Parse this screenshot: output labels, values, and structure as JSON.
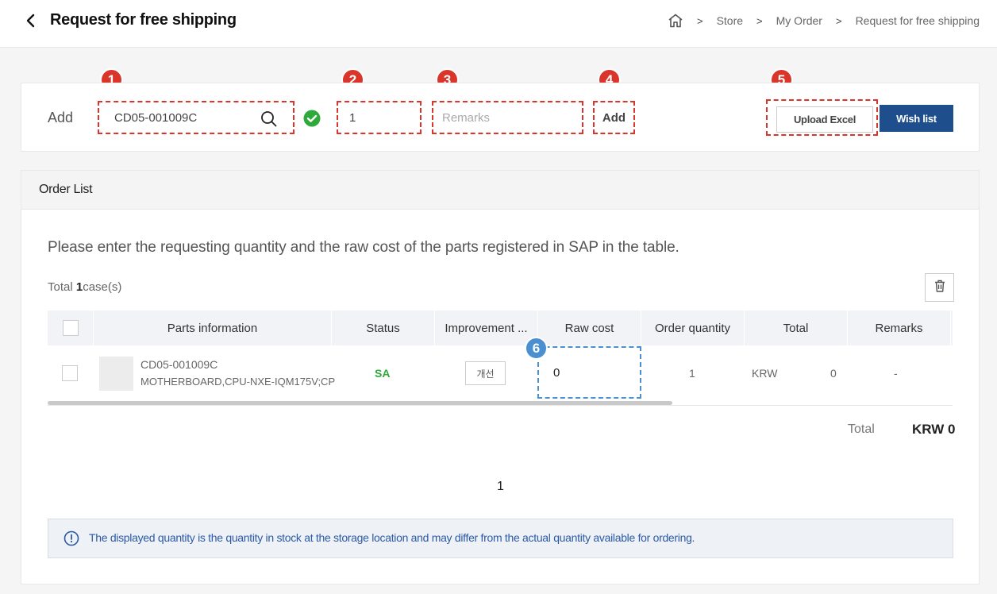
{
  "header": {
    "title": "Request for free shipping",
    "breadcrumb": [
      "Store",
      "My Order",
      "Request for free shipping"
    ]
  },
  "add_bar": {
    "label": "Add",
    "part_code_value": "CD05-001009C",
    "quantity_value": "1",
    "remarks_placeholder": "Remarks",
    "add_button": "Add",
    "upload_excel_button": "Upload Excel",
    "wish_list_button": "Wish list"
  },
  "annotations": [
    "1",
    "2",
    "3",
    "4",
    "5",
    "6"
  ],
  "order_list": {
    "title": "Order List",
    "instruction": "Please enter the requesting quantity and the raw cost of the parts registered in SAP in the table.",
    "total_prefix": "Total",
    "total_count": "1",
    "total_suffix": "case(s)",
    "columns": [
      "Parts information",
      "Status",
      "Improvement ...",
      "Raw cost",
      "Order quantity",
      "Total",
      "Remarks"
    ],
    "rows": [
      {
        "part_code": "CD05-001009C",
        "part_name": "MOTHERBOARD,CPU-NXE-IQM175V;CP",
        "status": "SA",
        "improvement_button": "개선",
        "raw_cost": "0",
        "order_quantity": "1",
        "currency": "KRW",
        "total": "0",
        "remarks": "-"
      }
    ],
    "summary_label": "Total",
    "summary_value": "KRW 0",
    "current_page": "1"
  },
  "notice": "The displayed quantity is the quantity in stock at the storage location and may differ from the actual quantity available for ordering.",
  "colors": {
    "primary": "#1f4e8c",
    "annotation_red": "#d9352a",
    "annotation_blue": "#4a8fd0",
    "status_green": "#2eaa3a",
    "notice_text": "#2b5aa6"
  }
}
